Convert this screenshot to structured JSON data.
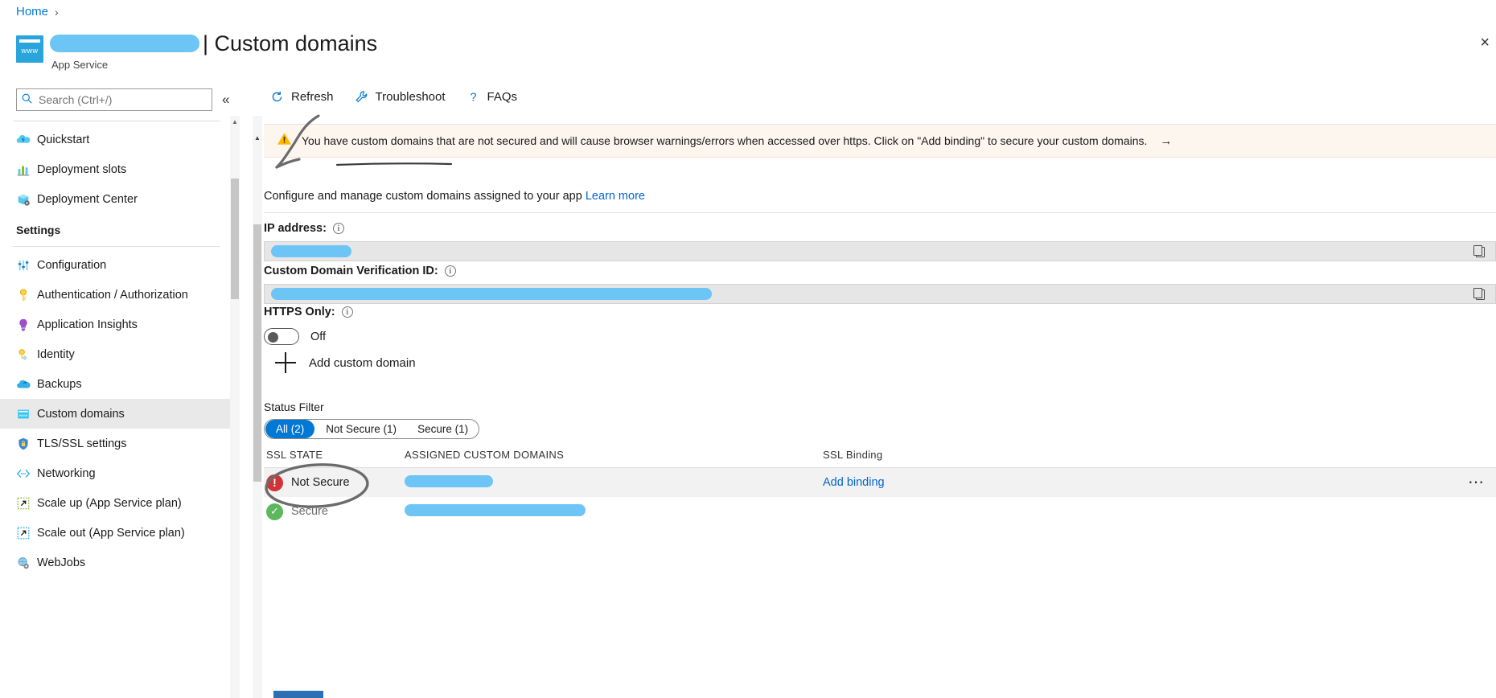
{
  "breadcrumb": {
    "home": "Home",
    "separator": "›"
  },
  "header": {
    "resource_name_redacted": true,
    "page_title": "| Custom domains",
    "subtitle": "App Service",
    "icon": "app-service-www-icon",
    "close_label": "×"
  },
  "sidebar": {
    "search": {
      "placeholder": "Search (Ctrl+/)",
      "value": "",
      "icon": "search-icon"
    },
    "collapse_icon": "«",
    "items": [
      {
        "label": "Quickstart",
        "icon": "quickstart-cloud-icon",
        "selected": false
      },
      {
        "label": "Deployment slots",
        "icon": "deployment-slots-chart-icon",
        "selected": false
      },
      {
        "label": "Deployment Center",
        "icon": "deployment-center-box-icon",
        "selected": false
      }
    ],
    "section_label": "Settings",
    "settings_items": [
      {
        "label": "Configuration",
        "icon": "configuration-sliders-icon",
        "selected": false
      },
      {
        "label": "Authentication / Authorization",
        "icon": "key-icon",
        "selected": false
      },
      {
        "label": "Application Insights",
        "icon": "lightbulb-icon",
        "selected": false
      },
      {
        "label": "Identity",
        "icon": "identity-key-icon",
        "selected": false
      },
      {
        "label": "Backups",
        "icon": "backups-cloud-icon",
        "selected": false
      },
      {
        "label": "Custom domains",
        "icon": "custom-domains-www-icon",
        "selected": true
      },
      {
        "label": "TLS/SSL settings",
        "icon": "shield-lock-icon",
        "selected": false
      },
      {
        "label": "Networking",
        "icon": "networking-icon",
        "selected": false
      },
      {
        "label": "Scale up (App Service plan)",
        "icon": "scale-up-icon",
        "selected": false
      },
      {
        "label": "Scale out (App Service plan)",
        "icon": "scale-out-icon",
        "selected": false
      },
      {
        "label": "WebJobs",
        "icon": "webjobs-gear-icon",
        "selected": false
      }
    ]
  },
  "toolbar": {
    "refresh": {
      "label": "Refresh",
      "icon": "refresh-icon"
    },
    "troubleshoot": {
      "label": "Troubleshoot",
      "icon": "wrench-icon"
    },
    "faqs": {
      "label": "FAQs",
      "icon": "question-mark-icon"
    }
  },
  "banner": {
    "icon": "warning-triangle-icon",
    "text": "You have custom domains that are not secured and will cause browser warnings/errors when accessed over https. Click on \"Add binding\" to secure your custom domains.",
    "arrow": "→"
  },
  "main": {
    "description": "Configure and manage custom domains assigned to your app",
    "description_link": "Learn more",
    "ip_address": {
      "label": "IP address:",
      "info_icon": "info-icon",
      "value_redacted": true,
      "copy_icon": "copy-icon"
    },
    "verification_id": {
      "label": "Custom Domain Verification ID:",
      "info_icon": "info-icon",
      "value_redacted": true,
      "copy_icon": "copy-icon"
    },
    "https_only": {
      "label": "HTTPS Only:",
      "info_icon": "info-icon",
      "state": "Off",
      "enabled": false
    },
    "add_custom_domain": {
      "label": "Add custom domain",
      "icon": "plus-icon"
    }
  },
  "status_filter": {
    "title": "Status Filter",
    "pills": [
      {
        "label": "All (2)",
        "active": true
      },
      {
        "label": "Not Secure (1)",
        "active": false
      },
      {
        "label": "Secure (1)",
        "active": false
      }
    ]
  },
  "table": {
    "columns": [
      "SSL STATE",
      "ASSIGNED CUSTOM DOMAINS",
      "SSL Binding"
    ],
    "rows": [
      {
        "state": "Not Secure",
        "state_icon": "error-circle-icon",
        "domain_redacted": true,
        "domain_blob_width": 110,
        "binding_label": "Add binding",
        "menu_icon": "ellipsis-icon",
        "highlighted": true,
        "annotated": true
      },
      {
        "state": "Secure",
        "state_icon": "success-check-icon",
        "domain_redacted": true,
        "domain_blob_width": 225,
        "binding_label": "",
        "menu_icon": "",
        "highlighted": false,
        "annotated": false
      }
    ]
  },
  "annotations": {
    "arrow_to_refresh": "hand-drawn-arrow",
    "circle_around_not_secure": "hand-drawn-ellipse",
    "pen_color": "#6b6b6b"
  }
}
